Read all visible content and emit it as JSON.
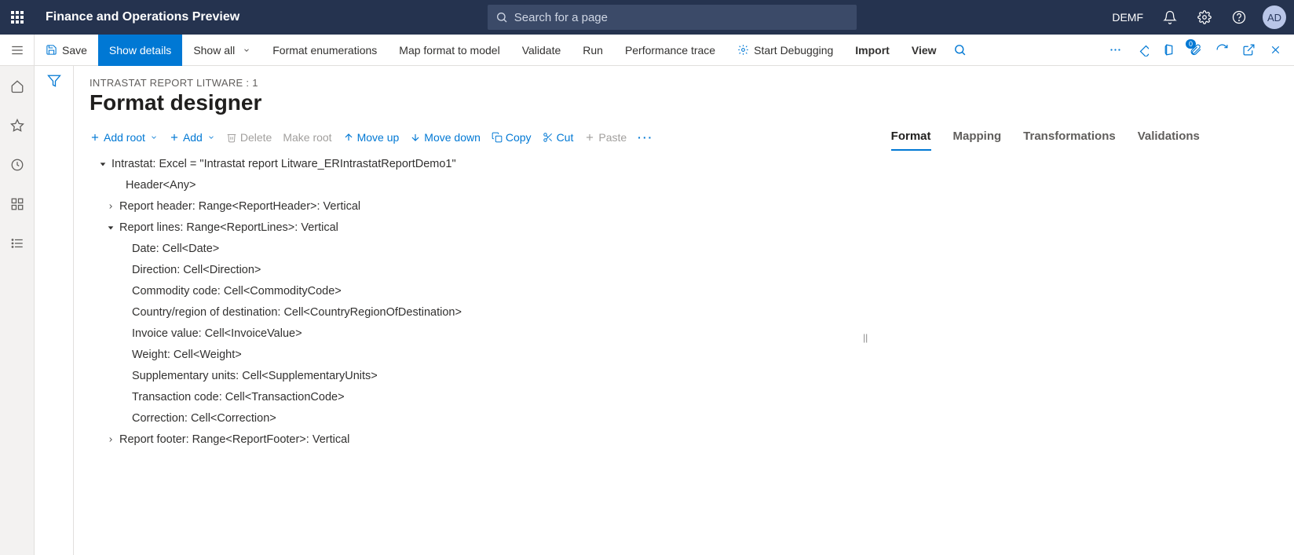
{
  "header": {
    "app_title": "Finance and Operations Preview",
    "search_placeholder": "Search for a page",
    "company": "DEMF",
    "avatar": "AD"
  },
  "action_bar": {
    "save": "Save",
    "show_details": "Show details",
    "show_all": "Show all",
    "format_enum": "Format enumerations",
    "map_format": "Map format to model",
    "validate": "Validate",
    "run": "Run",
    "perf_trace": "Performance trace",
    "start_debug": "Start Debugging",
    "import": "Import",
    "view": "View",
    "badge_count": "0"
  },
  "page": {
    "breadcrumb": "INTRASTAT REPORT LITWARE : 1",
    "title": "Format designer"
  },
  "toolbar": {
    "add_root": "Add root",
    "add": "Add",
    "delete": "Delete",
    "make_root": "Make root",
    "move_up": "Move up",
    "move_down": "Move down",
    "copy": "Copy",
    "cut": "Cut",
    "paste": "Paste"
  },
  "tree": {
    "root": "Intrastat: Excel = \"Intrastat report Litware_ERIntrastatReportDemo1\"",
    "header": "Header<Any>",
    "report_header": "Report header: Range<ReportHeader>: Vertical",
    "report_lines": "Report lines: Range<ReportLines>: Vertical",
    "cells": [
      "Date: Cell<Date>",
      "Direction: Cell<Direction>",
      "Commodity code: Cell<CommodityCode>",
      "Country/region of destination: Cell<CountryRegionOfDestination>",
      "Invoice value: Cell<InvoiceValue>",
      "Weight: Cell<Weight>",
      "Supplementary units: Cell<SupplementaryUnits>",
      "Transaction code: Cell<TransactionCode>",
      "Correction: Cell<Correction>"
    ],
    "report_footer": "Report footer: Range<ReportFooter>: Vertical"
  },
  "tabs": {
    "format": "Format",
    "mapping": "Mapping",
    "transformations": "Transformations",
    "validations": "Validations"
  }
}
